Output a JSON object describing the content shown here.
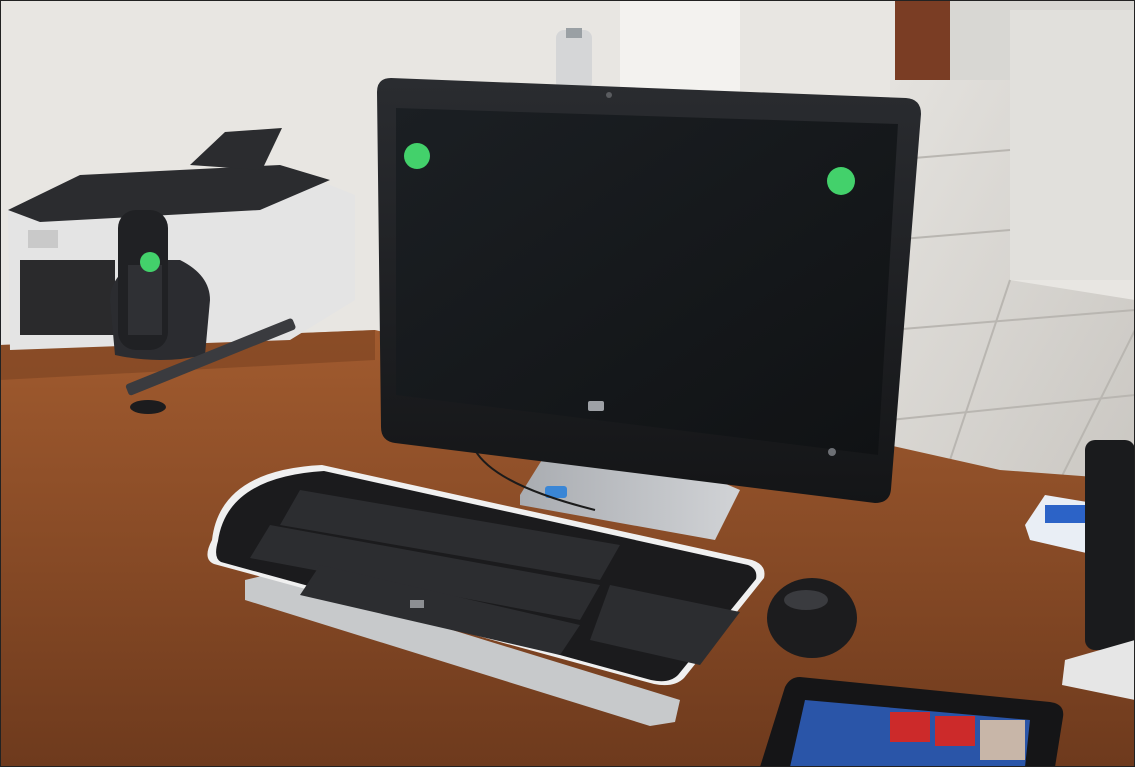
{
  "scene": {
    "title": "",
    "brand_mark_monitor": "",
    "brand_mark_keyboard": ""
  },
  "colors": {
    "wall": "#e9e6e2",
    "floor": "#d9d7d2",
    "desk": "#8e4e28",
    "monitor_bezel": "#1e1f22",
    "screen": "#15181b",
    "marker_green": "#43d16b",
    "printer_body": "#e5e5e5",
    "printer_top": "#2a2b2e",
    "keyboard": "#1b1b1d",
    "stand": "#b8bbc0"
  },
  "markers": [
    {
      "label": "marker-1"
    },
    {
      "label": "marker-2"
    },
    {
      "label": "marker-3"
    }
  ]
}
